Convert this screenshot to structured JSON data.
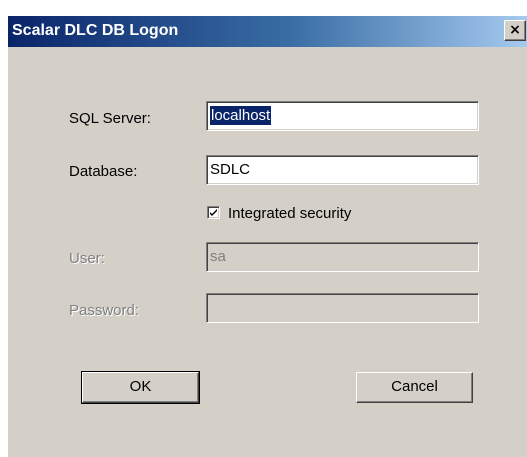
{
  "window": {
    "title": "Scalar DLC DB Logon",
    "close_glyph": "×"
  },
  "form": {
    "sql_server": {
      "label": "SQL Server:",
      "value": "localhost"
    },
    "database": {
      "label": "Database:",
      "value": "SDLC"
    },
    "integrated_security": {
      "label": "Integrated security",
      "checked": true
    },
    "user": {
      "label": "User:",
      "value": "sa"
    },
    "password": {
      "label": "Password:",
      "value": ""
    }
  },
  "buttons": {
    "ok_label": "OK",
    "cancel_label": "Cancel"
  },
  "colors": {
    "titlebar_start": "#0a246a",
    "titlebar_end": "#a6caf0",
    "dialog_face": "#d4d0c8",
    "selection": "#0a246a"
  }
}
